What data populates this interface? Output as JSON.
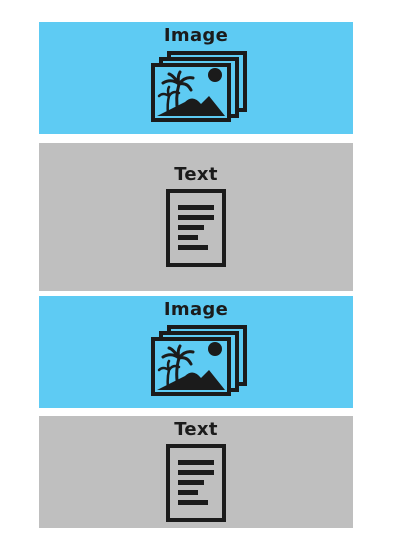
{
  "colors": {
    "image_block": "#5ecbf3",
    "text_block": "#bfbfbf",
    "icon_stroke": "#1b1b1b"
  },
  "blocks": [
    {
      "kind": "image",
      "label": "Image",
      "icon": "image-gallery-icon"
    },
    {
      "kind": "text",
      "label": "Text",
      "icon": "text-document-icon"
    },
    {
      "kind": "image",
      "label": "Image",
      "icon": "image-gallery-icon"
    },
    {
      "kind": "text",
      "label": "Text",
      "icon": "text-document-icon"
    }
  ]
}
